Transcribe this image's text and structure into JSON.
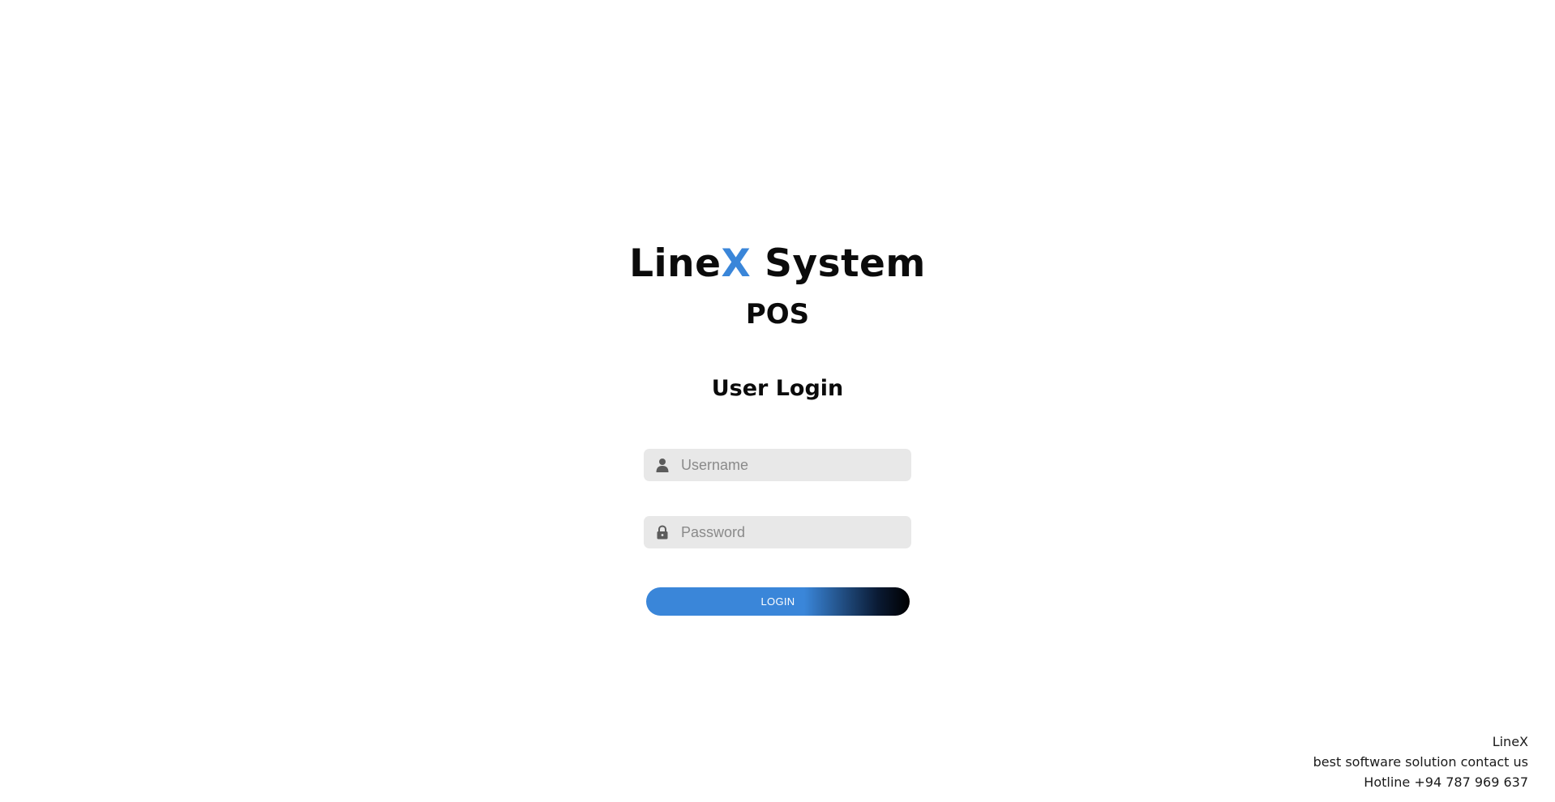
{
  "header": {
    "brand_prefix": "Line",
    "brand_accent": "X",
    "brand_suffix": " System",
    "subtitle": "POS"
  },
  "login": {
    "title": "User Login",
    "username": {
      "placeholder": "Username",
      "value": "",
      "icon": "user-icon"
    },
    "password": {
      "placeholder": "Password",
      "value": "",
      "icon": "lock-icon"
    },
    "button_label": "LOGIN"
  },
  "footer": {
    "company": "LineX",
    "tagline": "best software solution contact us",
    "hotline": "Hotline +94 787 969 637"
  },
  "colors": {
    "accent": "#3a86d9",
    "text": "#0b0b0b",
    "field_bg": "#e8e8e8",
    "button_gradient_end": "#000000"
  }
}
